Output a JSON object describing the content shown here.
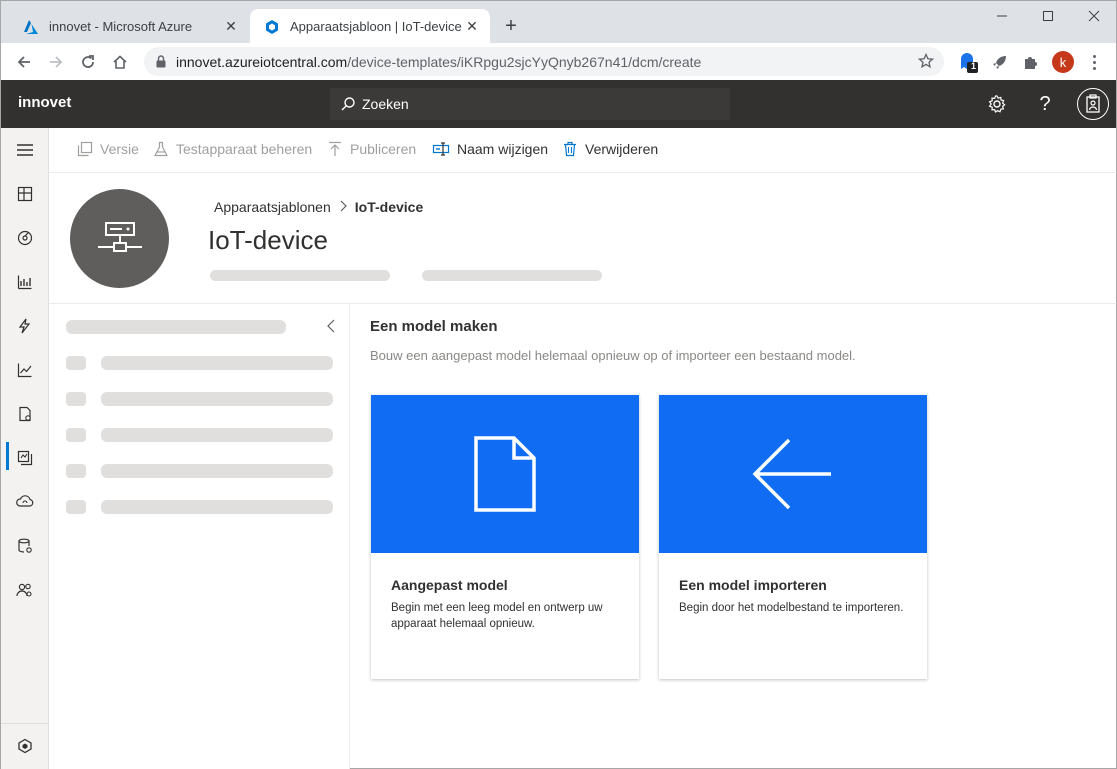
{
  "browser": {
    "tabs": [
      {
        "title": "innovet - Microsoft Azure",
        "icon": "azure-icon",
        "active": false
      },
      {
        "title": "Apparaatsjabloon | IoT-device, in",
        "icon": "iot-central-icon",
        "active": true
      }
    ],
    "url_host": "innovet.azureiotcentral.com",
    "url_path": "/device-templates/iKRpgu2sjcYyQnyb267n41/dcm/create",
    "extension_badge": "1",
    "profile_initial": "k"
  },
  "app": {
    "brand": "innovet",
    "search_placeholder": "Zoeken"
  },
  "commands": [
    {
      "label": "Versie",
      "icon": "copy-icon",
      "enabled": false
    },
    {
      "label": "Testapparaat beheren",
      "icon": "flask-icon",
      "enabled": false
    },
    {
      "label": "Publiceren",
      "icon": "upload-icon",
      "enabled": false
    },
    {
      "label": "Naam wijzigen",
      "icon": "rename-icon",
      "enabled": true
    },
    {
      "label": "Verwijderen",
      "icon": "trash-icon",
      "enabled": true
    }
  ],
  "header": {
    "breadcrumb_parent": "Apparaatsjablonen",
    "breadcrumb_current": "IoT-device",
    "title": "IoT-device"
  },
  "main": {
    "title": "Een model maken",
    "subtitle": "Bouw een aangepast model helemaal opnieuw op of importeer een bestaand model.",
    "cards": [
      {
        "title": "Aangepast model",
        "description": "Begin met een leeg model en ontwerp uw apparaat helemaal opnieuw.",
        "icon": "document-icon"
      },
      {
        "title": "Een model importeren",
        "description": "Begin door het modelbestand te importeren.",
        "icon": "arrow-left-icon"
      }
    ]
  },
  "colors": {
    "accent": "#0f6cf3",
    "header_bg": "#323130",
    "rail_active": "#0078d4"
  }
}
